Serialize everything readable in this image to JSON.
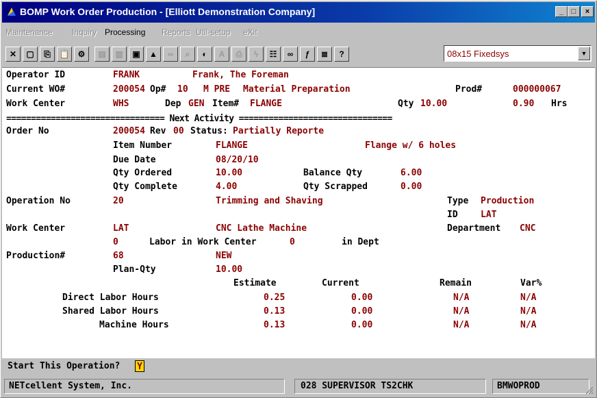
{
  "window": {
    "title": "BOMP Work Order Production - [Elliott Demonstration Company]",
    "controls": {
      "minimize": "_",
      "maximize": "□",
      "close": "×"
    }
  },
  "menu": [
    "Maintenance",
    "Inquiry",
    "Processing",
    "Reports",
    "Util-setup",
    "eXit"
  ],
  "toolbar": {
    "font_value": "08x15 Fixedsys",
    "buttons": [
      {
        "name": "close-icon",
        "glyph": "✕",
        "enabled": true
      },
      {
        "name": "select-icon",
        "glyph": "▢",
        "enabled": true
      },
      {
        "name": "copy-icon",
        "glyph": "⎘",
        "enabled": true
      },
      {
        "name": "paste-icon",
        "glyph": "📋",
        "enabled": true
      },
      {
        "name": "settings-icon",
        "glyph": "⚙",
        "enabled": true
      },
      {
        "name": "document-icon",
        "glyph": "▤",
        "enabled": false
      },
      {
        "name": "list-icon",
        "glyph": "▥",
        "enabled": false
      },
      {
        "name": "screen-icon",
        "glyph": "▣",
        "enabled": true
      },
      {
        "name": "warning-icon",
        "glyph": "▲",
        "enabled": true
      },
      {
        "name": "binoculars-icon",
        "glyph": "∞",
        "enabled": false
      },
      {
        "name": "magnifier-icon",
        "glyph": "⌕",
        "enabled": false
      },
      {
        "name": "palette-icon",
        "glyph": "◐",
        "enabled": true
      },
      {
        "name": "text-icon",
        "glyph": "A",
        "enabled": false
      },
      {
        "name": "print-icon",
        "glyph": "⎙",
        "enabled": false
      },
      {
        "name": "lightning-icon",
        "glyph": "ϟ",
        "enabled": false
      },
      {
        "name": "clipboard-icon",
        "glyph": "☷",
        "enabled": true
      },
      {
        "name": "link-icon",
        "glyph": "∞",
        "enabled": true
      },
      {
        "name": "function-icon",
        "glyph": "ƒ",
        "enabled": true
      },
      {
        "name": "notes-icon",
        "glyph": "≣",
        "enabled": true
      },
      {
        "name": "help-icon",
        "glyph": "?",
        "enabled": true
      }
    ]
  },
  "screen": {
    "operator_label": "Operator ID",
    "operator_id": "FRANK",
    "operator_name": "Frank, The Foreman",
    "wo_label": "Current WO#",
    "wo_no": "200054",
    "op_label": "Op#",
    "op_no": "10",
    "op_code": "M PRE",
    "op_desc": "Material Preparation",
    "prod_label": "Prod#",
    "prod_no": "000000067",
    "wc_label": "Work Center",
    "wc": "WHS",
    "dep_label": "Dep",
    "dep": "GEN",
    "item_label": "Item#",
    "item": "FLANGE",
    "qty_label": "Qty",
    "qty": "10.00",
    "hrs": "0.90",
    "hrs_label": "Hrs",
    "separator": "================================ Next Activity ===============================",
    "order_label": "Order No",
    "order_no": "200054",
    "rev_label": "Rev",
    "rev": "00",
    "status_label": "Status:",
    "status": "Partially Reporte",
    "item_number_label": "Item Number",
    "item_number": "FLANGE",
    "item_desc": "Flange w/ 6 holes",
    "due_label": "Due Date",
    "due": "08/20/10",
    "qty_ordered_label": "Qty Ordered",
    "qty_ordered": "10.00",
    "balance_label": "Balance Qty",
    "balance": "6.00",
    "qty_complete_label": "Qty Complete",
    "qty_complete": "4.00",
    "scrapped_label": "Qty Scrapped",
    "scrapped": "0.00",
    "operation_label": "Operation No",
    "operation_no": "20",
    "operation_desc": "Trimming and Shaving",
    "type_label": "Type",
    "type": "Production",
    "id_label": "ID",
    "id": "LAT",
    "wc2_label": "Work Center",
    "wc2": "LAT",
    "wc2_desc": "CNC Lathe Machine",
    "dept_label": "Department",
    "dept": "CNC",
    "labor_count": "0",
    "labor_in_wc_label": "Labor in Work Center",
    "labor_in_wc": "0",
    "in_dept_label": "in Dept",
    "production_label": "Production#",
    "production_no": "68",
    "production_status": "NEW",
    "plan_qty_label": "Plan-Qty",
    "plan_qty": "10.00",
    "hours_table": {
      "headers": [
        "Estimate",
        "Current",
        "Remain",
        "Var%"
      ],
      "rows": [
        {
          "label": "Direct Labor Hours",
          "estimate": "0.25",
          "current": "0.00",
          "remain": "N/A",
          "var": "N/A"
        },
        {
          "label": "Shared Labor Hours",
          "estimate": "0.13",
          "current": "0.00",
          "remain": "N/A",
          "var": "N/A"
        },
        {
          "label": "Machine Hours",
          "estimate": "0.13",
          "current": "0.00",
          "remain": "N/A",
          "var": "N/A"
        }
      ]
    }
  },
  "prompt": {
    "question": "Start This Operation?",
    "answer": "Y"
  },
  "status_bar": {
    "company": "NETcellent System, Inc.",
    "session": "028 SUPERVISOR TS2CHK",
    "program": "BMWOPROD"
  }
}
